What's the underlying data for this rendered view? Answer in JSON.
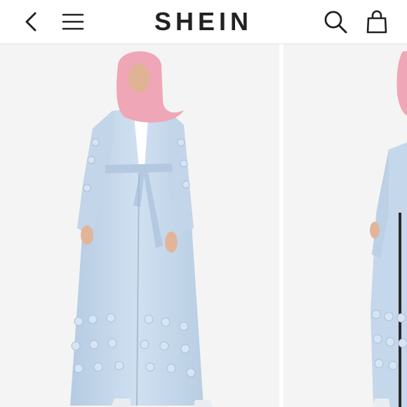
{
  "header": {
    "logo_text": "SHEIN",
    "icons": {
      "back": "chevron-left-icon",
      "menu": "hamburger-menu-icon",
      "search": "search-icon",
      "bag": "shopping-bag-icon"
    }
  },
  "gallery": {
    "image_count_visible": 2
  },
  "colors": {
    "text": "#222222",
    "background": "#f4f4f4",
    "dress": "#c5d7ea",
    "scarf": "#ef9fb3"
  }
}
